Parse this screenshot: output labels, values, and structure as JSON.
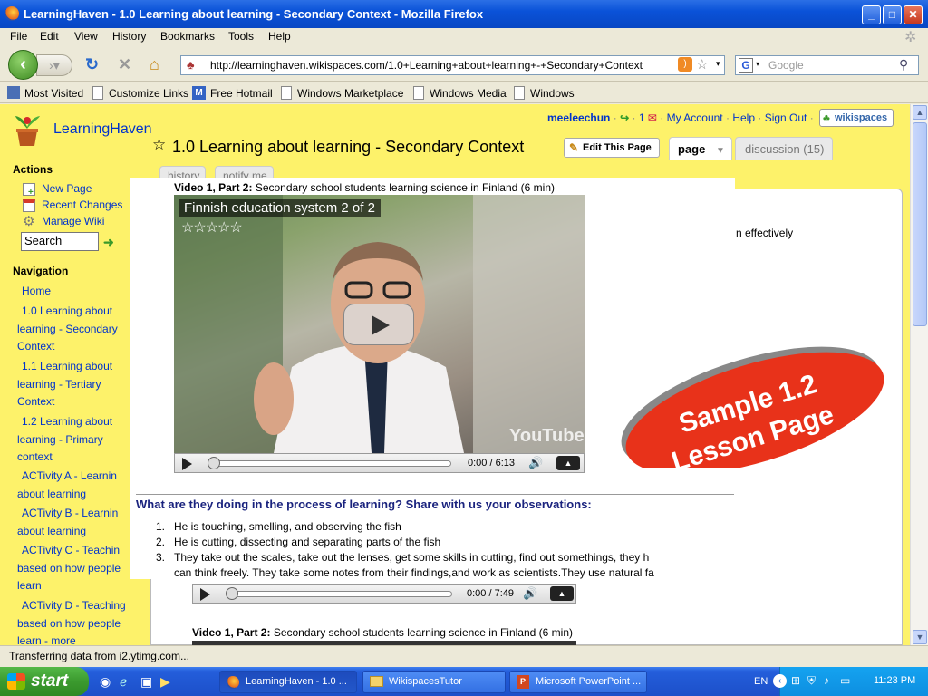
{
  "window": {
    "title": "LearningHaven - 1.0 Learning about learning - Secondary Context - Mozilla Firefox"
  },
  "menu": [
    "File",
    "Edit",
    "View",
    "History",
    "Bookmarks",
    "Tools",
    "Help"
  ],
  "address": {
    "url": "http://learninghaven.wikispaces.com/1.0+Learning+about+learning+-+Secondary+Context"
  },
  "search": {
    "placeholder": "Google"
  },
  "bookmarks": [
    "Most Visited",
    "Customize Links",
    "Free Hotmail",
    "Windows Marketplace",
    "Windows Media",
    "Windows"
  ],
  "site": {
    "name": "LearningHaven",
    "user": "meeleechun",
    "message_count": "1",
    "links": [
      "My Account",
      "Help",
      "Sign Out"
    ],
    "badge": "wikispaces",
    "page_title": "1.0 Learning about learning - Secondary Context",
    "edit_label": "Edit This Page",
    "tab_page": "page",
    "tab_discussion": "discussion (15)",
    "subtab_history": "history",
    "subtab_notify": "notify me"
  },
  "sidebar": {
    "actions_heading": "Actions",
    "actions": [
      "New Page",
      "Recent Changes",
      "Manage Wiki"
    ],
    "search_value": "Search",
    "nav_heading": "Navigation",
    "nav": [
      "Home",
      "1.0 Learning about learning - Secondary Context",
      "1.1 Learning about learning - Tertiary Context",
      "1.2 Learning about learning - Primary context",
      "ACTivity A - Learnin about learning",
      "ACTivity B - Learnin about learning",
      "ACTivity C - Teachin based on how people learn",
      "ACTivity D - Teaching based on how people learn - more"
    ]
  },
  "main": {
    "video1_caption_bold": "Video 1, Part 2:",
    "video1_caption": " Secondary school students learning science in Finland (6 min)",
    "video1_title": "Finnish education system 2 of 2",
    "video1_time": "0:00 / 6:13",
    "video1_logo": "YouTube",
    "background_text": "n effectively",
    "question": "What are they doing in the process of learning? Share with us your observations:",
    "observations": [
      "He is touching, smelling, and observing the fish",
      "He is cutting, dissecting and separating parts of the fish",
      "They take out the scales, take out the lenses, get some skills in cutting, find out somethings, they h",
      "can think freely. They take some notes from their findings,and work as scientists.They use natural fa"
    ],
    "video2_time": "0:00 / 7:49",
    "video3_caption_bold": "Video 1, Part 2:",
    "video3_caption": " Secondary school students learning science in Finland (6 min)"
  },
  "banner": {
    "line1": "Sample 1.2",
    "line2": "Lesson Page",
    "color": "#e8321a"
  },
  "status": {
    "text": "Transferring data from i2.ytimg.com..."
  },
  "taskbar": {
    "start": "start",
    "tasks": [
      "LearningHaven - 1.0 ...",
      "WikispacesTutor",
      "Microsoft PowerPoint ..."
    ],
    "lang": "EN",
    "clock": "11:23 PM"
  }
}
